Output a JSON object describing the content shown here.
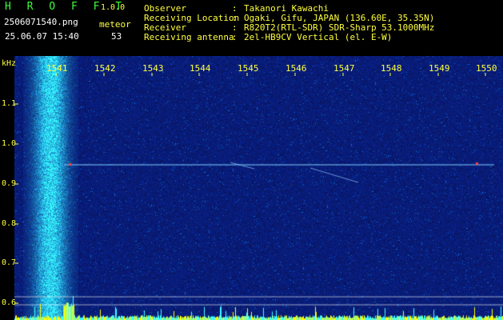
{
  "header": {
    "app_name": "H R O F F T",
    "version": "1.0.0",
    "filename": "2506071540.png",
    "datetime": "25.06.07 15:40",
    "count_label": "meteor",
    "count_value": "53",
    "fields": [
      {
        "label": "Observer",
        "sep": ":",
        "value": "Takanori Kawachi"
      },
      {
        "label": "Receiving Location",
        "sep": ":",
        "value": "Ogaki, Gifu, JAPAN (136.60E, 35.35N)"
      },
      {
        "label": "Receiver",
        "sep": ":",
        "value": "R820T2(RTL-SDR) SDR-Sharp 53.1000MHz"
      },
      {
        "label": "Receiving antenna",
        "sep": ":",
        "value": "2el-HB9CV Vertical (el. E-W)"
      }
    ]
  },
  "axes": {
    "y_unit": "kHz",
    "x_ticks": [
      "1541",
      "1542",
      "1543",
      "1544",
      "1545",
      "1546",
      "1547",
      "1548",
      "1549",
      "1550"
    ],
    "y_ticks": [
      "1.1",
      "1.0",
      "0.9",
      "0.8",
      "0.7",
      "0.6"
    ]
  },
  "colors": {
    "background": "#000000",
    "logo": "#3cff3c",
    "label": "#ffff40",
    "text": "#ffffff",
    "spectrum_bg": "#0a1460",
    "carrier": "#7fd0ff",
    "activity": "#ffff00"
  }
}
